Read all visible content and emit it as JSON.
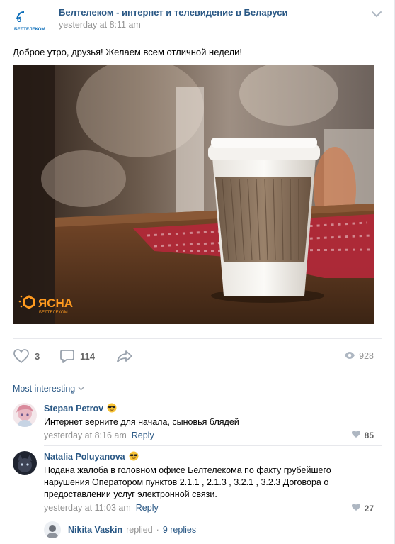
{
  "post": {
    "owner": "Белтелеком - интернет и телевидение в Беларуси",
    "time": "yesterday at 8:11 am",
    "text": "Доброе утро, друзья! Желаем всем отличной недели!",
    "logo_text": "БЕЛТЕЛЕКОМ",
    "photo_brand": "ЯСНА",
    "photo_brand_sub": "БЕЛТЕЛЕКОМ"
  },
  "actions": {
    "likes": "3",
    "comments": "114",
    "views": "928"
  },
  "comments_sort": "Most interesting",
  "comments": [
    {
      "author": "Stepan Petrov",
      "text": "Интернет верните для начала, сыновья блядей",
      "time": "yesterday at 8:16 am",
      "reply_label": "Reply",
      "likes": "85"
    },
    {
      "author": "Natalia Poluyanova",
      "text": "Подана жалоба в головном офисе Белтелекома по факту грубейшего нарушения Оператором пунктов 2.1.1 , 2.1.3 , 3.2.1 , 3.2.3 Договора о предоставлении услуг электронной связи.",
      "time": "yesterday at 11:03 am",
      "reply_label": "Reply",
      "likes": "27"
    }
  ],
  "thread": {
    "author": "Nikita Vaskin",
    "replied": "replied",
    "separator": "·",
    "count": "9 replies"
  },
  "colors": {
    "link": "#2a5885",
    "meta": "#939393",
    "divider": "#e7e8ec"
  },
  "icons": [
    "belltelecom-logo",
    "chevron-down-icon",
    "heart-icon",
    "comment-icon",
    "share-icon",
    "eye-icon",
    "sunglasses-emoji",
    "heart-small-icon"
  ]
}
